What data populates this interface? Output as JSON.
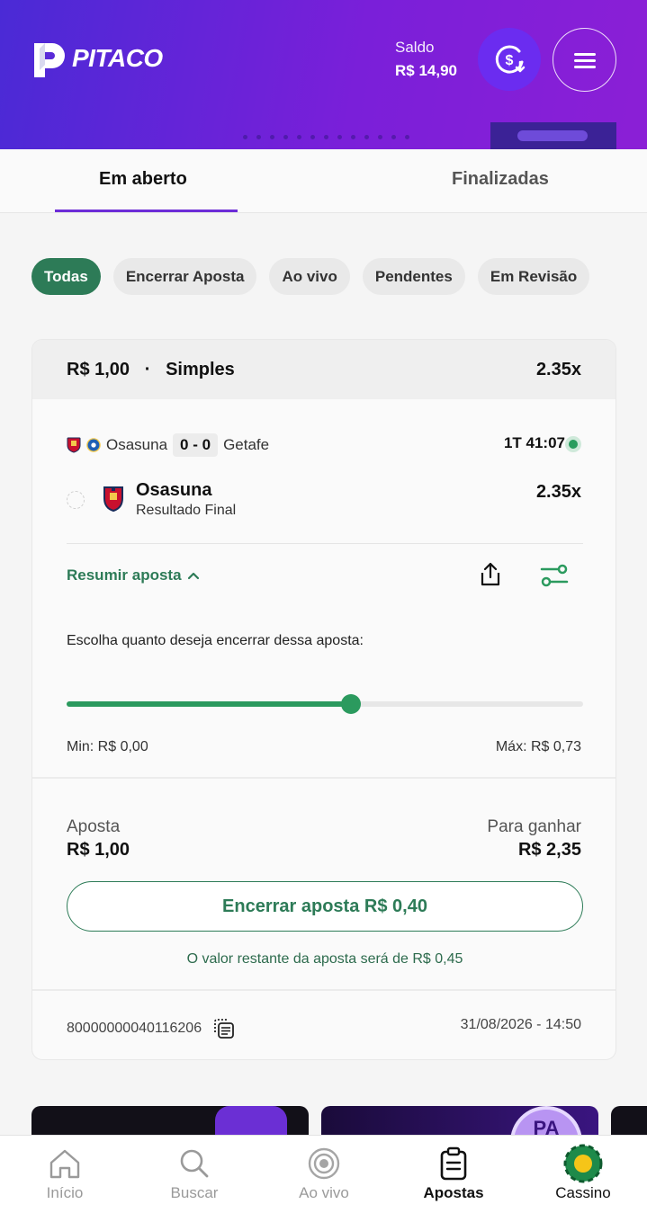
{
  "header": {
    "brand": "PITACO",
    "saldo_label": "Saldo",
    "saldo_value": "R$ 14,90"
  },
  "tabs": [
    {
      "label": "Em aberto",
      "active": true
    },
    {
      "label": "Finalizadas",
      "active": false
    }
  ],
  "filters": [
    {
      "label": "Todas",
      "active": true
    },
    {
      "label": "Encerrar Aposta",
      "active": false
    },
    {
      "label": "Ao vivo",
      "active": false
    },
    {
      "label": "Pendentes",
      "active": false
    },
    {
      "label": "Em Revisão",
      "active": false
    }
  ],
  "bet": {
    "stake": "R$ 1,00",
    "separator": "·",
    "type": "Simples",
    "total_odds": "2.35x",
    "home_team": "Osasuna",
    "away_team": "Getafe",
    "score": "0 - 0",
    "live_time": "1T  41:07",
    "selection": "Osasuna",
    "market": "Resultado Final",
    "selection_odds": "2.35x",
    "summary_link": "Resumir aposta",
    "choose_text": "Escolha quanto deseja encerrar dessa aposta:",
    "slider_fraction": 0.55,
    "min_text": "Min: R$ 0,00",
    "max_text": "Máx: R$ 0,73",
    "bet_label": "Aposta",
    "bet_value": "R$ 1,00",
    "win_label": "Para ganhar",
    "win_value": "R$ 2,35",
    "cashout_button": "Encerrar aposta R$ 0,40",
    "remaining_text": "O valor restante da aposta será de R$ 0,45",
    "bet_id": "80000000040116206",
    "date": "31/08/2026 - 14:50"
  },
  "bottom_nav": [
    {
      "label": "Início",
      "icon": "home-icon"
    },
    {
      "label": "Buscar",
      "icon": "search-icon"
    },
    {
      "label": "Ao vivo",
      "icon": "live-icon"
    },
    {
      "label": "Apostas",
      "icon": "clipboard-icon"
    },
    {
      "label": "Cassino",
      "icon": "casino-icon"
    }
  ],
  "colors": {
    "accent_green": "#2d7b57",
    "header_purple": "#6c2cd8"
  }
}
